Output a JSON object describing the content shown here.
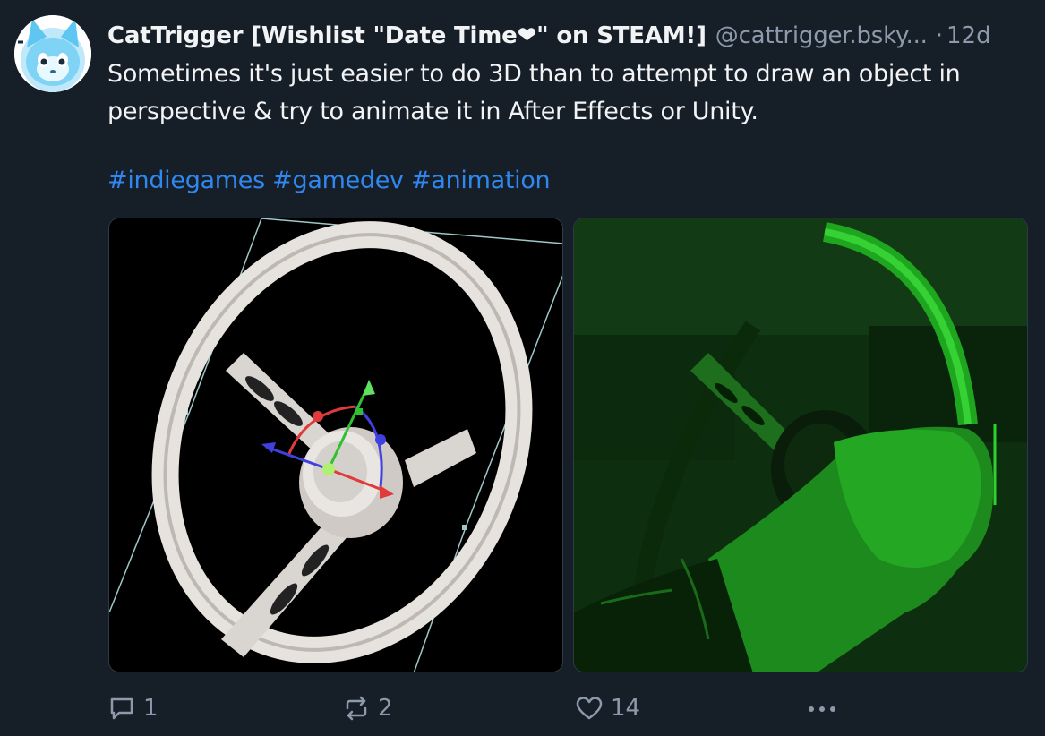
{
  "post": {
    "author": {
      "display_name": "CatTrigger [Wishlist \"Date Time❤\" on STEAM!]",
      "handle": "@cattrigger.bsky...",
      "avatar_icon": "cat-avatar"
    },
    "age_separator": "·",
    "age": "12d",
    "text_lines": [
      "Sometimes it's just easier to do 3D than to attempt to draw an object in",
      "perspective & try to animate it in After Effects or Unity."
    ],
    "hashtags": [
      "#indiegames",
      "#gamedev",
      "#animation"
    ],
    "images": [
      {
        "icon": "steering-wheel-3d-render-image"
      },
      {
        "icon": "steering-wheel-green-pixel-animation-image"
      }
    ],
    "actions": {
      "reply_count": "1",
      "repost_count": "2",
      "like_count": "14"
    }
  },
  "colors": {
    "background": "#161e27",
    "text": "#f1f3f5",
    "muted": "#8d9aab",
    "link": "#2f87ef"
  }
}
